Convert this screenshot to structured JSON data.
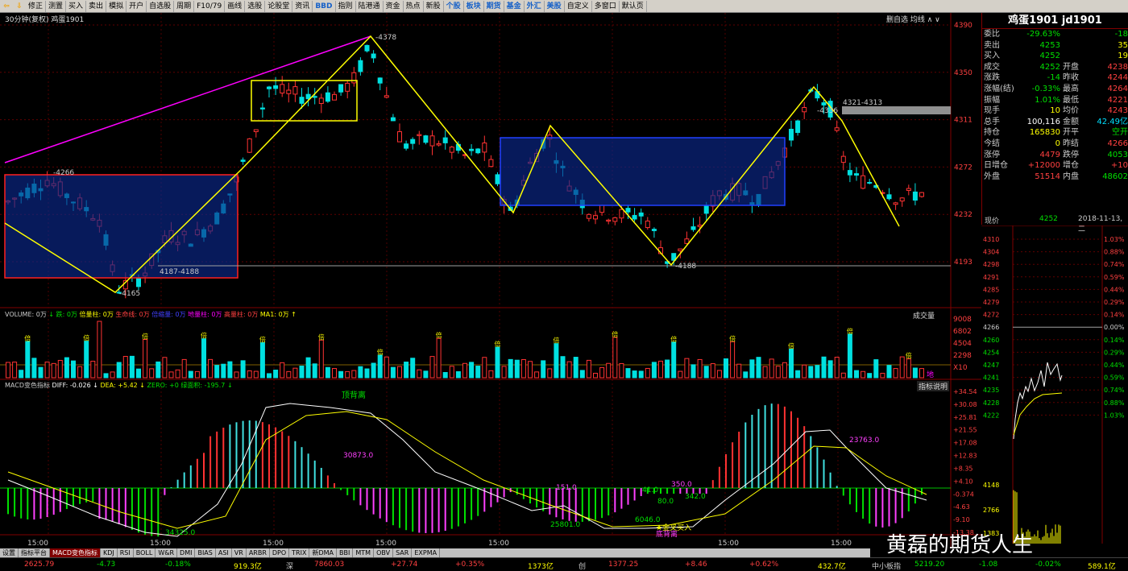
{
  "toolbar": {
    "items": [
      "修正",
      "测置",
      "买入",
      "卖出",
      "模拟",
      "开户",
      "自选股",
      "周期",
      "F10/79",
      "画线",
      "选股",
      "论股堂",
      "资讯",
      "BBD",
      "指则",
      "陆港通",
      "资金",
      "热点",
      "新股",
      "个股",
      "板块",
      "期货",
      "基金",
      "外汇",
      "美股",
      "自定义",
      "多窗口",
      "默认页"
    ],
    "highlight": [
      "BBD",
      "个股",
      "板块",
      "期货",
      "基金",
      "外汇",
      "美股"
    ]
  },
  "chart": {
    "title": "30分钟(复权) 鸡蛋1901",
    "controls": "删自选 均线 ∧ ∨"
  },
  "price_axis": [
    "4390",
    "4350",
    "4311",
    "4272",
    "4232",
    "4193"
  ],
  "annotations": {
    "high_left": "4266",
    "low_left": "4165",
    "box_label": "4187-4188",
    "peak": "4378",
    "bottom": "4188",
    "right_peak": "4336",
    "right_box": "4321-4313"
  },
  "time_labels": [
    "15:00",
    "15:00",
    "15:00",
    "15:00",
    "15:00",
    "15:00",
    "15:00",
    "15:00"
  ],
  "volume": {
    "legend": [
      {
        "text": "VOLUME: 0万",
        "color": "#cccccc"
      },
      {
        "text": "↓ 跌: 0万",
        "color": "#00e000"
      },
      {
        "text": "倍量柱: 0万",
        "color": "#ffff00"
      },
      {
        "text": "生命线: 0万",
        "color": "#ff4040"
      },
      {
        "text": "倍缩量: 0万",
        "color": "#4040ff"
      },
      {
        "text": "地量柱: 0万",
        "color": "#ff00ff"
      },
      {
        "text": "高量柱: 0万",
        "color": "#ff4040"
      },
      {
        "text": "MA1: 0万 ↑",
        "color": "#ffff00"
      }
    ],
    "button": "成交量",
    "axis": [
      "9008",
      "6802",
      "4504",
      "2298",
      "X10"
    ],
    "bei_label": "倍",
    "di_label": "地"
  },
  "macd": {
    "legend": [
      {
        "text": "MACD变色指标",
        "color": "#cccccc"
      },
      {
        "text": "DIFF: -0.026 ↓",
        "color": "#ffffff"
      },
      {
        "text": "DEA: +5.42 ↓",
        "color": "#ffff00"
      },
      {
        "text": "ZERO: +0",
        "color": "#00e000"
      },
      {
        "text": "绿面积: -195.7 ↓",
        "color": "#00e000"
      }
    ],
    "button": "指标说明",
    "axis": [
      "+34.54",
      "+30.08",
      "+25.81",
      "+21.55",
      "+17.08",
      "+12.83",
      "+8.35",
      "+4.10",
      "-0.374",
      "-4.63",
      "-9.10",
      "-13.38"
    ],
    "labels": {
      "top_divergence": "顶背离",
      "a": "30873.0",
      "b": "34325.0",
      "c": "25801.0",
      "d": "151.0",
      "e": "41.0",
      "f": "80.0",
      "g": "350.0",
      "h": "342.0",
      "i": "6046.0",
      "j": "23763.0",
      "golden": "★金叉买入",
      "bottom_divergence": "底背离"
    }
  },
  "indicator_tabs": [
    "设置",
    "指标平台",
    "MACD变色指标",
    "KDJ",
    "RSI",
    "BOLL",
    "W&R",
    "DMI",
    "BIAS",
    "ASI",
    "VR",
    "ARBR",
    "DPO",
    "TRIX",
    "新DMA",
    "BBI",
    "MTM",
    "OBV",
    "SAR",
    "EXPMA"
  ],
  "status": {
    "v1": "2625.79",
    "v2": "-4.73",
    "v3": "-0.18%",
    "v4": "919.3亿",
    "shen": "深",
    "v5": "7860.03",
    "v6": "+27.74",
    "v7": "+0.35%",
    "v8": "1373亿",
    "chuang": "创",
    "v9": "1377.25",
    "v10": "+8.46",
    "v11": "+0.62%",
    "v12": "432.7亿",
    "zxb": "中小板指",
    "v13": "5219.20",
    "v14": "-1.08",
    "v15": "-0.02%",
    "v16": "589.1亿"
  },
  "quote": {
    "title": "鸡蛋1901 jd1901",
    "rows": [
      {
        "l1": "委比",
        "v1": "-29.63%",
        "c1": "#00e000",
        "l2": "",
        "v2": "-18",
        "c2": "#00e000"
      },
      {
        "l1": "卖出",
        "v1": "4253",
        "c1": "#00e000",
        "l2": "",
        "v2": "35",
        "c2": "#ffff00"
      },
      {
        "l1": "买入",
        "v1": "4252",
        "c1": "#00e000",
        "l2": "",
        "v2": "19",
        "c2": "#ffff00"
      },
      {
        "l1": "成交",
        "v1": "4252",
        "c1": "#00e000",
        "l2": "开盘",
        "v2": "4238",
        "c2": "#ff4040"
      },
      {
        "l1": "涨跌",
        "v1": "-14",
        "c1": "#00e000",
        "l2": "昨收",
        "v2": "4244",
        "c2": "#ff4040"
      },
      {
        "l1": "涨幅(结)",
        "v1": "-0.33%",
        "c1": "#00e000",
        "l2": "最高",
        "v2": "4264",
        "c2": "#ff4040"
      },
      {
        "l1": "振幅",
        "v1": "1.01%",
        "c1": "#00e000",
        "l2": "最低",
        "v2": "4221",
        "c2": "#ff4040"
      },
      {
        "l1": "现手",
        "v1": "10",
        "c1": "#ffff00",
        "l2": "均价",
        "v2": "4243",
        "c2": "#ff4040"
      },
      {
        "l1": "总手",
        "v1": "100,116",
        "c1": "#ffffff",
        "l2": "金额",
        "v2": "42.49亿",
        "c2": "#00e0ff"
      },
      {
        "l1": "持仓",
        "v1": "165830",
        "c1": "#ffff00",
        "l2": "开平",
        "v2": "空开",
        "c2": "#00e000"
      },
      {
        "l1": "今结",
        "v1": "0",
        "c1": "#ffff00",
        "l2": "昨结",
        "v2": "4266",
        "c2": "#ff4040"
      },
      {
        "l1": "涨停",
        "v1": "4479",
        "c1": "#ff4040",
        "l2": "跌停",
        "v2": "4053",
        "c2": "#00e000"
      },
      {
        "l1": "日增仓",
        "v1": "+12000",
        "c1": "#ff4040",
        "l2": "增仓",
        "v2": "+10",
        "c2": "#ff4040"
      },
      {
        "l1": "外盘",
        "v1": "51514",
        "c1": "#ff4040",
        "l2": "内盘",
        "v2": "48602",
        "c2": "#00e000"
      }
    ]
  },
  "mini": {
    "price_label": "现价",
    "price": "4252",
    "date": "2018-11-13,二",
    "left_axis": [
      "4310",
      "4304",
      "4298",
      "4291",
      "4285",
      "4279",
      "4272",
      "4266",
      "4260",
      "4254",
      "4247",
      "4241",
      "4235",
      "4228",
      "4222",
      "4148",
      "2766",
      "1383"
    ],
    "right_axis": [
      "1.03%",
      "0.88%",
      "0.74%",
      "0.59%",
      "0.44%",
      "0.29%",
      "0.14%",
      "0.00%",
      "0.14%",
      "0.29%",
      "0.44%",
      "0.59%",
      "0.74%",
      "0.88%",
      "1.03%"
    ]
  },
  "watermark": "黄磊的期货人生"
}
